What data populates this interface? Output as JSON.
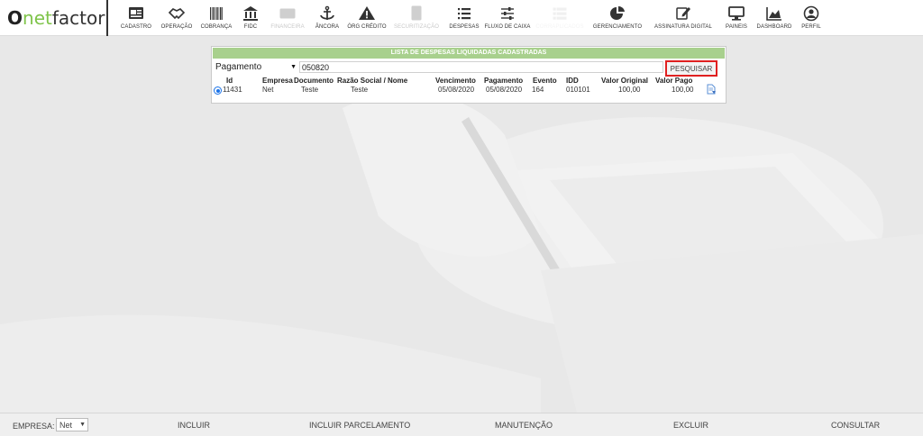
{
  "brand": {
    "o": "O",
    "net": "net",
    "factor": "factor"
  },
  "nav": [
    {
      "label": "CADASTRO",
      "icon": "id-card-icon",
      "state": "normal"
    },
    {
      "label": "OPERAÇÃO",
      "icon": "handshake-icon",
      "state": "normal"
    },
    {
      "label": "COBRANÇA",
      "icon": "barcode-icon",
      "state": "normal"
    },
    {
      "label": "FIDC",
      "icon": "bank-icon",
      "state": "normal"
    },
    {
      "label": "FINANCEIRA",
      "icon": "money-icon",
      "state": "disabled"
    },
    {
      "label": "ÂNCORA",
      "icon": "anchor-icon",
      "state": "normal"
    },
    {
      "label": "ÓRG CRÉDITO",
      "icon": "warning-icon",
      "state": "normal"
    },
    {
      "label": "SECURITIZAÇÃO",
      "icon": "document-icon",
      "state": "disabled"
    },
    {
      "label": "DESPESAS",
      "icon": "list-icon",
      "state": "normal"
    },
    {
      "label": "FLUXO DE CAIXA",
      "icon": "sliders-icon",
      "state": "normal"
    },
    {
      "label": "CORRAPLICADOS",
      "icon": "list-icon",
      "state": "hidden"
    },
    {
      "label": "GERENCIAMENTO",
      "icon": "pie-chart-icon",
      "state": "normal"
    },
    {
      "label": "ASSINATURA DIGITAL",
      "icon": "edit-icon",
      "state": "normal"
    },
    {
      "label": "PAINEIS",
      "icon": "monitor-icon",
      "state": "normal"
    },
    {
      "label": "DASHBOARD",
      "icon": "area-chart-icon",
      "state": "normal"
    },
    {
      "label": "PERFIL",
      "icon": "user-icon",
      "state": "normal"
    }
  ],
  "panel": {
    "title": "LISTA DE DESPESAS LIQUIDADAS CADASTRADAS",
    "filter_select": "Pagamento",
    "search_value": "050820",
    "search_button": "PESQUISAR",
    "columns": {
      "id": "Id",
      "empresa": "Empresa",
      "documento": "Documento",
      "razao": "Razão Social / Nome",
      "vencimento": "Vencimento",
      "pagamento": "Pagamento",
      "evento": "Evento",
      "idd": "IDD",
      "valor_original": "Valor Original",
      "valor_pago": "Valor Pago"
    },
    "rows": [
      {
        "id": "11431",
        "empresa": "Net",
        "documento": "Teste",
        "razao": "Teste",
        "vencimento": "05/08/2020",
        "pagamento": "05/08/2020",
        "evento": "164",
        "idd": "010101",
        "valor_original": "100,00",
        "valor_pago": "100,00"
      }
    ]
  },
  "bottom": {
    "empresa_label": "EMPRESA:",
    "empresa_value": "Net",
    "incluir": "INCLUIR",
    "incluir_parcelamento": "INCLUIR PARCELAMENTO",
    "manutencao": "MANUTENÇÃO",
    "excluir": "EXCLUIR",
    "consultar": "CONSULTAR"
  },
  "colors": {
    "title_bar": "#a8d08d",
    "highlight_border": "#e02020",
    "radio": "#1a73e8",
    "brand_green": "#7fc44a"
  }
}
